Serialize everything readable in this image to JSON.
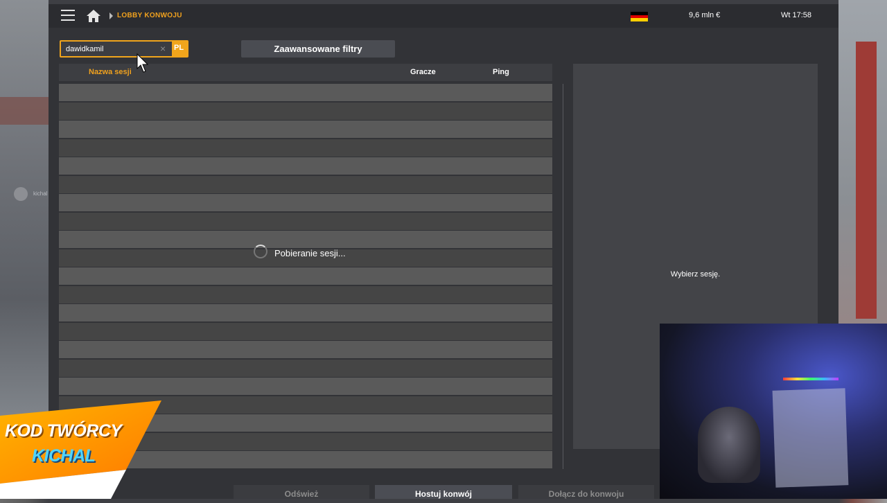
{
  "topbar": {
    "breadcrumb": "LOBBY KONWOJU",
    "money": "9,6 mln  €",
    "clock": "Wt 17:58",
    "flag_colors": [
      "#000000",
      "#dd0000",
      "#ffce00"
    ]
  },
  "search": {
    "value": "dawidkamil",
    "language_badge": "PL"
  },
  "filters_button": "Zaawansowane filtry",
  "table": {
    "columns": [
      "Nazwa sesji",
      "Gracze",
      "Ping"
    ],
    "loading_text": "Pobieranie sesji..."
  },
  "detail_panel": {
    "placeholder": "Wybierz sesję."
  },
  "bottom_actions": {
    "refresh": "Odśwież",
    "host": "Hostuj konwój",
    "join": "Dołącz do konwoju"
  },
  "overlay": {
    "creator_line1": "KOD TWÓRCY",
    "creator_line2": "KICHAL",
    "side_player_name": "kichal"
  },
  "colors": {
    "accent": "#f0a11e",
    "panel": "#323337"
  }
}
